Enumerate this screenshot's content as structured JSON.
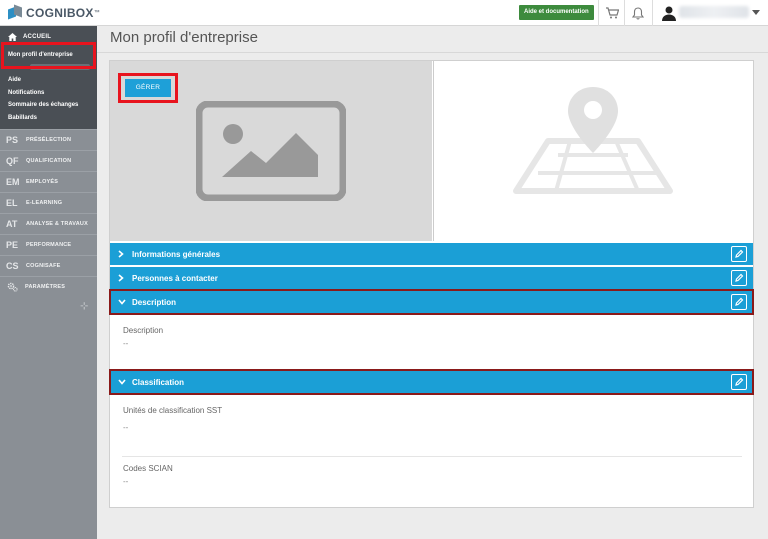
{
  "header": {
    "logo_text": "COGNIBOX",
    "logo_tm": "™",
    "help_label": "Aide et documentation"
  },
  "sidebar": {
    "home_label": "ACCUEIL",
    "sub_items": [
      {
        "label": "Mon profil d'entreprise",
        "active": true
      },
      {
        "label": "Aide"
      },
      {
        "label": "Notifications"
      },
      {
        "label": "Sommaire des échanges"
      },
      {
        "label": "Babillards"
      }
    ],
    "modules": [
      {
        "abbr": "PS",
        "label": "PRÉSÉLECTION"
      },
      {
        "abbr": "QF",
        "label": "QUALIFICATION"
      },
      {
        "abbr": "EM",
        "label": "EMPLOYÉS"
      },
      {
        "abbr": "EL",
        "label": "E-LEARNING"
      },
      {
        "abbr": "AT",
        "label": "ANALYSE & TRAVAUX"
      },
      {
        "abbr": "PE",
        "label": "PERFORMANCE"
      },
      {
        "abbr": "CS",
        "label": "COGNISAFE"
      },
      {
        "icon": "gears-icon",
        "label": "PARAMÈTRES"
      }
    ]
  },
  "main": {
    "page_title": "Mon profil d'entreprise",
    "manage_label": "GÉRER",
    "sections": [
      {
        "title": "Informations générales",
        "expanded": false
      },
      {
        "title": "Personnes à contacter",
        "expanded": false
      },
      {
        "title": "Description",
        "expanded": true
      },
      {
        "title": "Classification",
        "expanded": true
      }
    ],
    "description": {
      "label": "Description",
      "value": "--"
    },
    "classification": {
      "sst_label": "Unités de classification SST",
      "sst_value": "--",
      "scian_label": "Codes SCIAN",
      "scian_value": "--"
    }
  },
  "colors": {
    "accent_blue": "#1b9fd6",
    "help_green": "#3d8b3d",
    "highlight_red": "#e8141e",
    "outline_dark_red": "#8a1a1a",
    "sidebar_dark": "#4a4f55",
    "sidebar_gray": "#8a8f95"
  }
}
